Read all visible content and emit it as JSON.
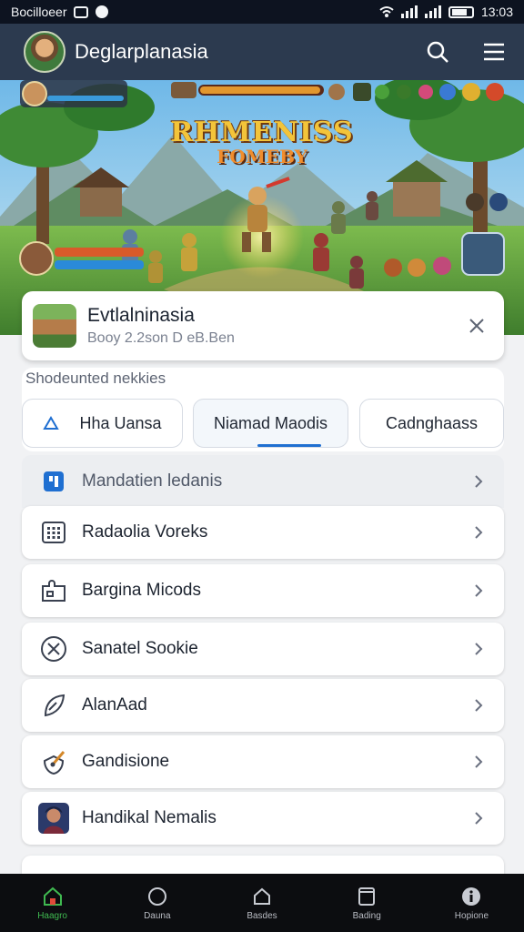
{
  "status_bar": {
    "left_text": "Bocilloeer",
    "time": "13:03"
  },
  "app_bar": {
    "title": "Deglarplanasia",
    "search_icon": "search-icon",
    "menu_icon": "hamburger-menu-icon"
  },
  "banner": {
    "title": "RHMENISS",
    "subtitle": "FOMEBY"
  },
  "game_card": {
    "title": "Evtlalninasia",
    "subtitle": "Booy 2.2son D eB.Ben"
  },
  "shortcut_section": {
    "label": "Shodeunted nekkies",
    "chips": [
      {
        "label": "Hha Uansa",
        "icon": "triangle-icon",
        "active": false
      },
      {
        "label": "Niamad Maodis",
        "active": true
      },
      {
        "label": "Cadnghaass",
        "active": false
      }
    ]
  },
  "menu": {
    "header": {
      "label": "Mandatien ledanis",
      "icon": "square-badge-icon"
    },
    "items": [
      {
        "label": "Radaolia Voreks",
        "icon": "grid-icon"
      },
      {
        "label": "Bargina Micods",
        "icon": "puzzle-icon"
      },
      {
        "label": "Sanatel Sookie",
        "icon": "crossed-tools-icon"
      },
      {
        "label": "AlanAad",
        "icon": "feather-icon"
      },
      {
        "label": "Gandisione",
        "icon": "sword-shield-icon"
      },
      {
        "label": "Handikal Nemalis",
        "icon": "character-portrait-icon"
      }
    ]
  },
  "bottom_nav": [
    {
      "label": "Haagro",
      "icon": "home-icon",
      "active": true
    },
    {
      "label": "Dauna",
      "icon": "circle-icon"
    },
    {
      "label": "Basdes",
      "icon": "house-outline-icon"
    },
    {
      "label": "Bading",
      "icon": "square-icon"
    },
    {
      "label": "Hopione",
      "icon": "info-circle-icon"
    }
  ],
  "colors": {
    "app_bar": "#2c3a4f",
    "status_bar": "#0d1320",
    "accent": "#1f6fd1",
    "nav_active": "#3fb950"
  }
}
